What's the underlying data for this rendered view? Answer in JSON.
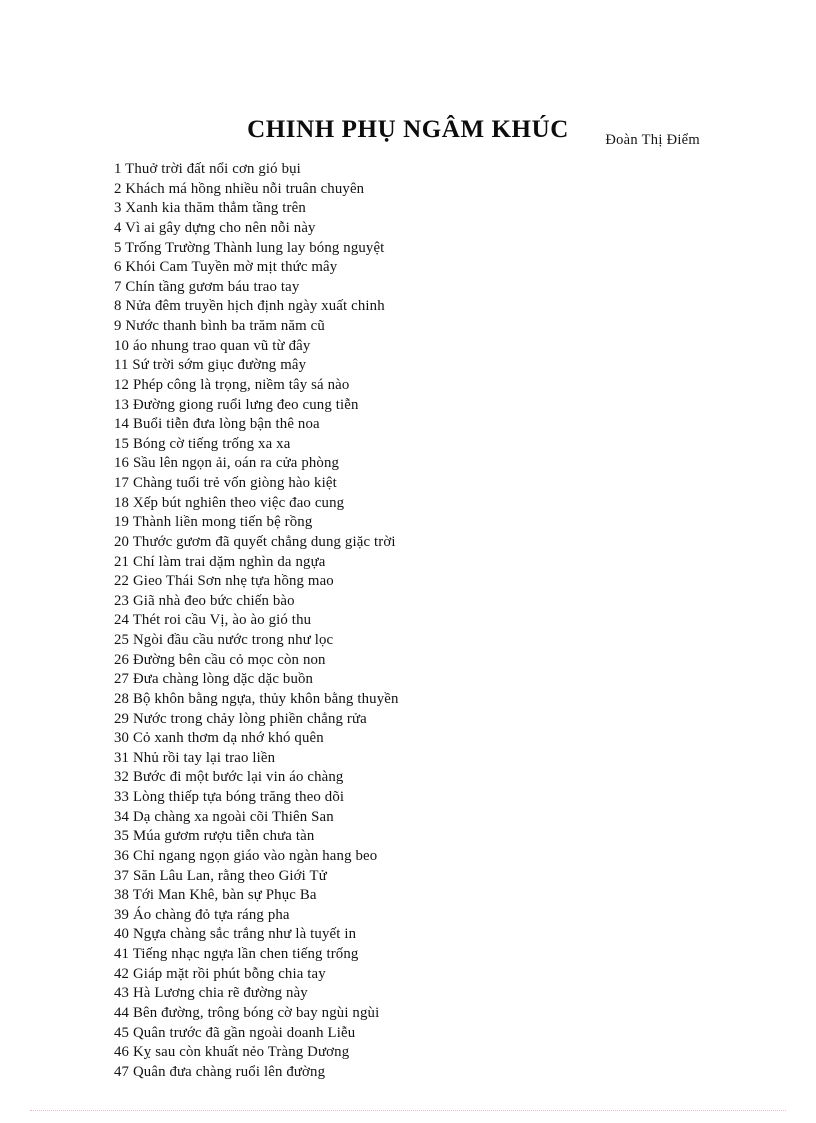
{
  "document": {
    "title": "CHINH PHỤ NGÂM KHÚC",
    "author": "Đoàn Thị Điểm",
    "colors": {
      "text": "#121212",
      "page_background": "#ffffff",
      "footer_rule": "#f4b8cf"
    },
    "lines": [
      {
        "number": "1",
        "text": "Thuở trời đất nổi cơn gió bụi"
      },
      {
        "number": "2",
        "text": "Khách má hồng nhiều nỗi truân chuyên"
      },
      {
        "number": "3",
        "text": "Xanh kia thăm thẳm tầng trên"
      },
      {
        "number": "4",
        "text": "Vì ai gây dựng cho nên nỗi này"
      },
      {
        "number": "5",
        "text": "Trống Trường Thành lung lay bóng nguyệt"
      },
      {
        "number": "6",
        "text": "Khói Cam Tuyền mờ mịt thức mây"
      },
      {
        "number": "7",
        "text": "Chín tầng gươm báu trao tay"
      },
      {
        "number": "8",
        "text": "Nửa đêm truyền hịch định ngày xuất chinh"
      },
      {
        "number": "9",
        "text": "Nước thanh bình ba trăm năm cũ"
      },
      {
        "number": "10",
        "text": "áo nhung trao quan vũ từ đây"
      },
      {
        "number": "11",
        "text": "Sứ trời sớm giục đường mây"
      },
      {
        "number": "12",
        "text": "Phép công là trọng, niềm tây sá nào"
      },
      {
        "number": "13",
        "text": "Đường giong ruổi lưng đeo cung tiễn"
      },
      {
        "number": "14",
        "text": "Buổi tiễn đưa lòng bận thê noa"
      },
      {
        "number": "15",
        "text": "Bóng cờ tiếng trống xa xa"
      },
      {
        "number": "16",
        "text": "Sầu lên ngọn ải, oán ra cửa phòng"
      },
      {
        "number": "17",
        "text": "Chàng tuổi trẻ vốn giòng hào kiệt"
      },
      {
        "number": "18",
        "text": "Xếp bút nghiên theo việc đao cung"
      },
      {
        "number": "19",
        "text": "Thành liền mong tiến bệ rồng"
      },
      {
        "number": "20",
        "text": "Thước gươm đã quyết chẳng dung giặc trời"
      },
      {
        "number": "21",
        "text": "Chí làm trai dặm nghìn da ngựa"
      },
      {
        "number": "22",
        "text": "Gieo Thái Sơn nhẹ tựa hồng mao"
      },
      {
        "number": "23",
        "text": "Giã nhà đeo bức chiến bào"
      },
      {
        "number": "24",
        "text": "Thét roi cầu Vị, ào ào gió thu"
      },
      {
        "number": "25",
        "text": "Ngòi đầu cầu nước trong như lọc"
      },
      {
        "number": "26",
        "text": "Đường bên cầu cỏ mọc còn non"
      },
      {
        "number": "27",
        "text": "Đưa chàng lòng dặc dặc buồn"
      },
      {
        "number": "28",
        "text": "Bộ khôn bằng ngựa, thủy khôn bằng thuyền"
      },
      {
        "number": "29",
        "text": "Nước trong chảy lòng phiền chẳng rửa"
      },
      {
        "number": "30",
        "text": "Cỏ xanh thơm dạ nhớ khó quên"
      },
      {
        "number": "31",
        "text": "Nhủ rồi tay lại trao liền"
      },
      {
        "number": "32",
        "text": "Bước đi một bước lại vin áo chàng"
      },
      {
        "number": "33",
        "text": "Lòng thiếp tựa bóng trăng theo dõi"
      },
      {
        "number": "34",
        "text": "Dạ chàng xa ngoài cõi Thiên San"
      },
      {
        "number": "35",
        "text": "Múa gươm rượu tiễn chưa tàn"
      },
      {
        "number": "36",
        "text": "Chỉ ngang ngọn giáo vào ngàn hang beo"
      },
      {
        "number": "37",
        "text": "Săn Lâu Lan, rằng theo Giới Tử"
      },
      {
        "number": "38",
        "text": "Tới Man Khê, bàn sự Phục Ba"
      },
      {
        "number": "39",
        "text": "Áo chàng đỏ tựa ráng pha"
      },
      {
        "number": "40",
        "text": "Ngựa chàng sắc trắng như là tuyết in"
      },
      {
        "number": "41",
        "text": "Tiếng nhạc ngựa lần chen tiếng trống"
      },
      {
        "number": "42",
        "text": "Giáp mặt rồi phút bỗng chia tay"
      },
      {
        "number": "43",
        "text": "Hà Lương chia rẽ đường này"
      },
      {
        "number": "44",
        "text": "Bên đường, trông bóng cờ bay ngùi ngùi"
      },
      {
        "number": "45",
        "text": "Quân trước đã gần ngoài doanh Liễu"
      },
      {
        "number": "46",
        "text": "Kỵ sau còn khuất nẻo Tràng Dương"
      },
      {
        "number": "47",
        "text": "Quân đưa chàng ruổi lên đường"
      }
    ]
  }
}
